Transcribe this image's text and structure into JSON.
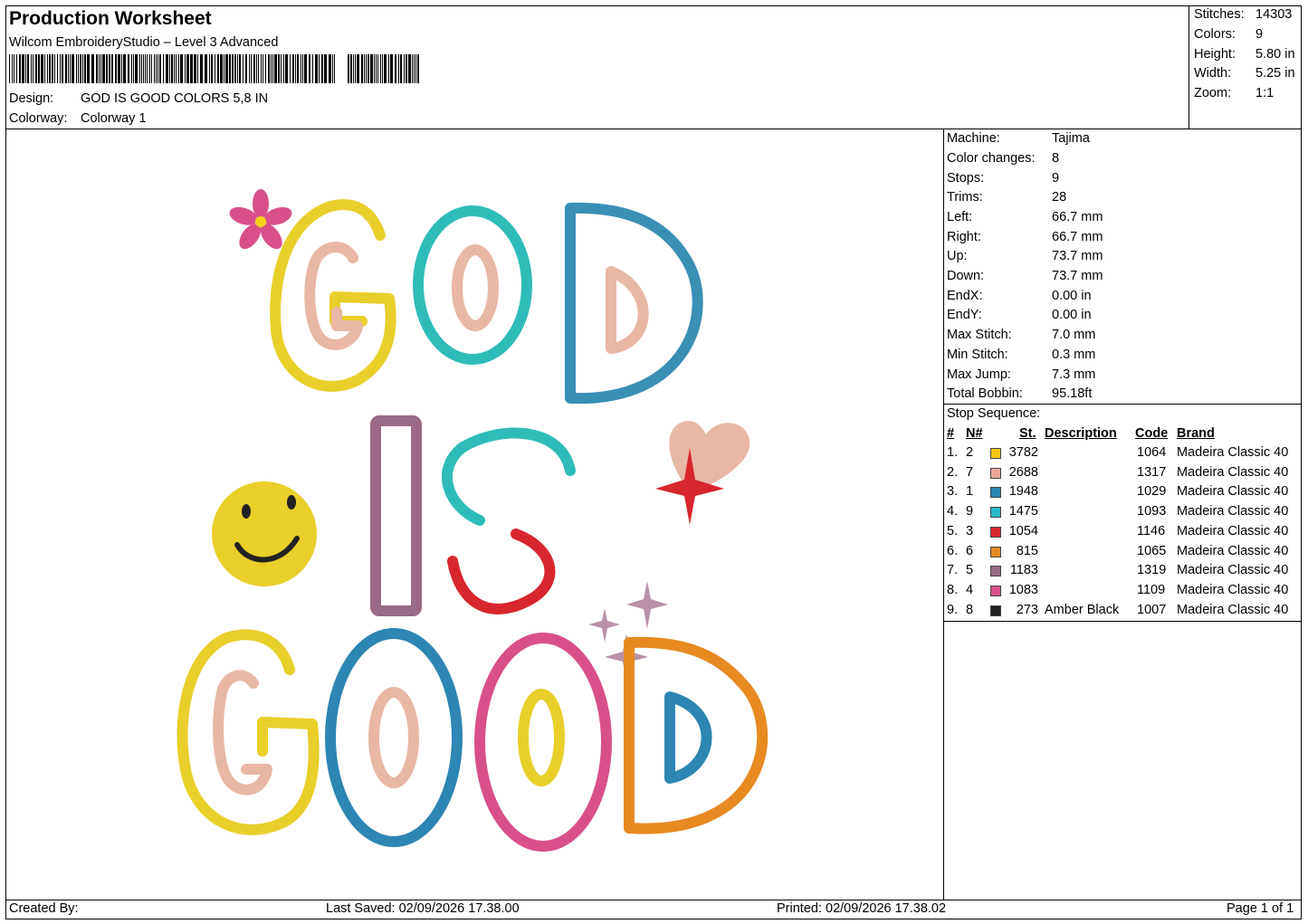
{
  "header": {
    "title": "Production Worksheet",
    "software": "Wilcom EmbroideryStudio – Level 3 Advanced",
    "design_label": "Design:",
    "design_value": "GOD IS GOOD COLORS 5,8 IN",
    "colorway_label": "Colorway:",
    "colorway_value": "Colorway 1"
  },
  "summary": [
    {
      "label": "Stitches:",
      "value": "14303"
    },
    {
      "label": "Colors:",
      "value": "9"
    },
    {
      "label": "Height:",
      "value": "5.80 in"
    },
    {
      "label": "Width:",
      "value": "5.25 in"
    },
    {
      "label": "Zoom:",
      "value": "1:1"
    }
  ],
  "machine_info": [
    {
      "label": "Machine:",
      "value": "Tajima"
    },
    {
      "label": "Color changes:",
      "value": "8"
    },
    {
      "label": "Stops:",
      "value": "9"
    },
    {
      "label": "Trims:",
      "value": "28"
    },
    {
      "label": "Left:",
      "value": "66.7 mm"
    },
    {
      "label": "Right:",
      "value": "66.7 mm"
    },
    {
      "label": "Up:",
      "value": "73.7 mm"
    },
    {
      "label": "Down:",
      "value": "73.7 mm"
    },
    {
      "label": "EndX:",
      "value": "0.00 in"
    },
    {
      "label": "EndY:",
      "value": "0.00 in"
    },
    {
      "label": "Max Stitch:",
      "value": "7.0 mm"
    },
    {
      "label": "Min Stitch:",
      "value": "0.3 mm"
    },
    {
      "label": "Max Jump:",
      "value": "7.3 mm"
    },
    {
      "label": "Total Bobbin:",
      "value": "95.18ft"
    }
  ],
  "stop_sequence": {
    "title": "Stop Sequence:",
    "columns": {
      "num": "#",
      "n": "N#",
      "st": "St.",
      "desc": "Description",
      "code": "Code",
      "brand": "Brand"
    },
    "rows": [
      {
        "num": "1.",
        "n": "2",
        "color": "#f5c518",
        "st": "3782",
        "desc": "",
        "code": "1064",
        "brand": "Madeira Classic 40"
      },
      {
        "num": "2.",
        "n": "7",
        "color": "#e8a89a",
        "st": "2688",
        "desc": "",
        "code": "1317",
        "brand": "Madeira Classic 40"
      },
      {
        "num": "3.",
        "n": "1",
        "color": "#2d86b3",
        "st": "1948",
        "desc": "",
        "code": "1029",
        "brand": "Madeira Classic 40"
      },
      {
        "num": "4.",
        "n": "9",
        "color": "#27b9c4",
        "st": "1475",
        "desc": "",
        "code": "1093",
        "brand": "Madeira Classic 40"
      },
      {
        "num": "5.",
        "n": "3",
        "color": "#d8262d",
        "st": "1054",
        "desc": "",
        "code": "1146",
        "brand": "Madeira Classic 40"
      },
      {
        "num": "6.",
        "n": "6",
        "color": "#e88a22",
        "st": "815",
        "desc": "",
        "code": "1065",
        "brand": "Madeira Classic 40"
      },
      {
        "num": "7.",
        "n": "5",
        "color": "#9a6a86",
        "st": "1183",
        "desc": "",
        "code": "1319",
        "brand": "Madeira Classic 40"
      },
      {
        "num": "8.",
        "n": "4",
        "color": "#d8508a",
        "st": "1083",
        "desc": "",
        "code": "1109",
        "brand": "Madeira Classic 40"
      },
      {
        "num": "9.",
        "n": "8",
        "color": "#222222",
        "st": "273",
        "desc": "Amber Black",
        "code": "1007",
        "brand": "Madeira Classic 40"
      }
    ]
  },
  "design_text": {
    "line1": "GOD",
    "line2": "IS",
    "line3": "GOOD"
  },
  "footer": {
    "created_by": "Created By:",
    "last_saved": "Last Saved: 02/09/2026 17.38.00",
    "printed": "Printed: 02/09/2026 17.38.02",
    "page": "Page 1 of 1"
  }
}
